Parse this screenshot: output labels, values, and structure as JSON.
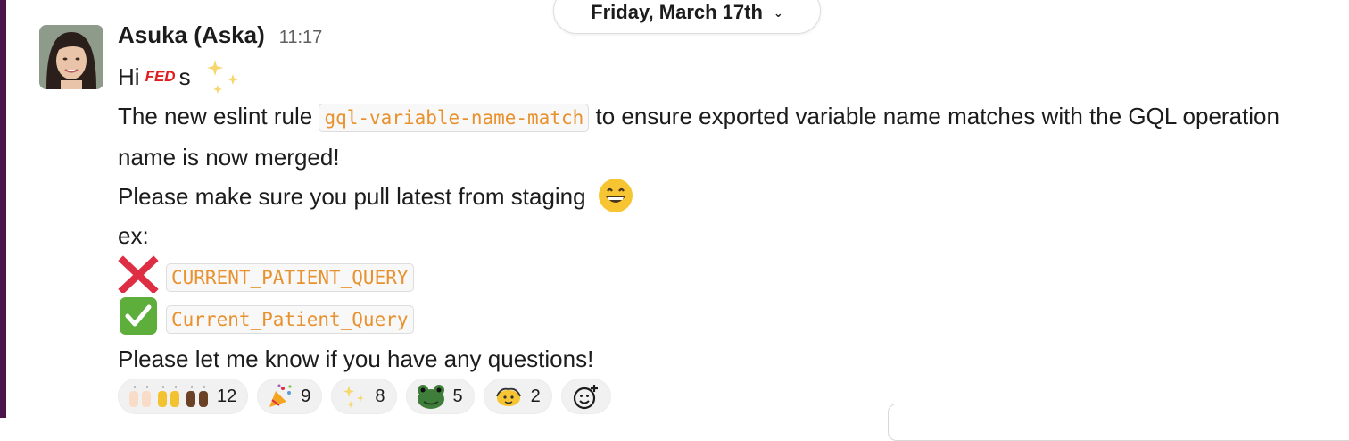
{
  "date_divider": {
    "label": "Friday, March 17th"
  },
  "message": {
    "sender": "Asuka (Aska)",
    "time": "11:17",
    "greeting_hi": "Hi",
    "greeting_badge": "FED",
    "greeting_suffix": "s",
    "line1_pre": "The new eslint rule",
    "line1_code": "gql-variable-name-match",
    "line1_post": "to ensure exported variable name matches with the GQL operation name is now merged!",
    "line2": "Please make sure you pull latest from staging",
    "line3": "ex:",
    "bad_example": "CURRENT_PATIENT_QUERY",
    "good_example": "Current_Patient_Query",
    "line4": "Please let me know if you have any questions!"
  },
  "reactions": [
    {
      "icon": "raised-hands-icons",
      "count": "12"
    },
    {
      "icon": "party-popper-icon",
      "count": "9"
    },
    {
      "icon": "sparkles-icon",
      "count": "8"
    },
    {
      "icon": "frog-icon",
      "count": "5"
    },
    {
      "icon": "dancing-emoji-icon",
      "count": "2"
    }
  ],
  "colors": {
    "code_text": "#e8912d",
    "rail": "#4a154b",
    "badge": "#e01e1e"
  }
}
